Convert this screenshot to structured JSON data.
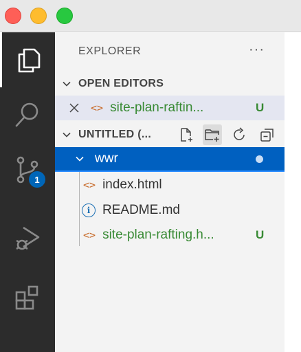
{
  "sidebar": {
    "title": "EXPLORER",
    "more": "···"
  },
  "open_editors": {
    "header": "OPEN EDITORS",
    "items": [
      {
        "icon_text": "<>",
        "name": "site-plan-raftin...",
        "status": "U"
      }
    ]
  },
  "workspace": {
    "header": "UNTITLED (...",
    "folder": "wwr",
    "files": [
      {
        "icon_text": "<>",
        "name": "index.html"
      },
      {
        "icon_text": "i",
        "name": "README.md"
      },
      {
        "icon_text": "<>",
        "name": "site-plan-rafting.h...",
        "status": "U"
      }
    ]
  },
  "activity": {
    "scm_badge": "1"
  }
}
